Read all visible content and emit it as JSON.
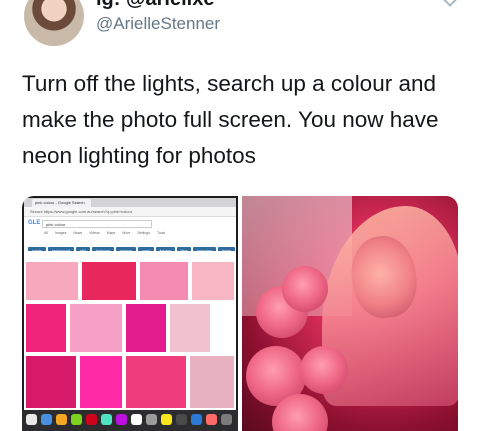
{
  "tweet": {
    "display_name": "ig: @arielixe",
    "handle": "@ArielleStenner",
    "text": "Turn off the lights, search up a colour and make the photo full screen. You now have neon lighting for photos"
  },
  "screenshot_browser": {
    "tab_title": "pink colour - Google Search",
    "address": "Secure https://www.google.com.au/search?q=pink+colour",
    "search_query": "pink colour",
    "logo_text": "GLE",
    "menu_items": [
      "All",
      "Images",
      "News",
      "Videos",
      "Maps",
      "More",
      "Settings",
      "Tools"
    ],
    "chips": [
      "purple",
      "background",
      "skin",
      "bedroom",
      "maroon",
      "coral",
      "fuschia",
      "blue",
      "turquoise",
      "brown",
      "lilac"
    ]
  },
  "colors": {
    "tile_colors": [
      "#f6a9bd",
      "#e8285c",
      "#f48bb0",
      "#f7b6c1",
      "#f0247a",
      "#f5a0c4",
      "#e31d8e",
      "#f2c1cf",
      "#d81a6b",
      "#ff2aa6",
      "#ef3d7b",
      "#e8b2c0"
    ],
    "text_primary": "#14171a",
    "text_secondary": "#657786"
  }
}
